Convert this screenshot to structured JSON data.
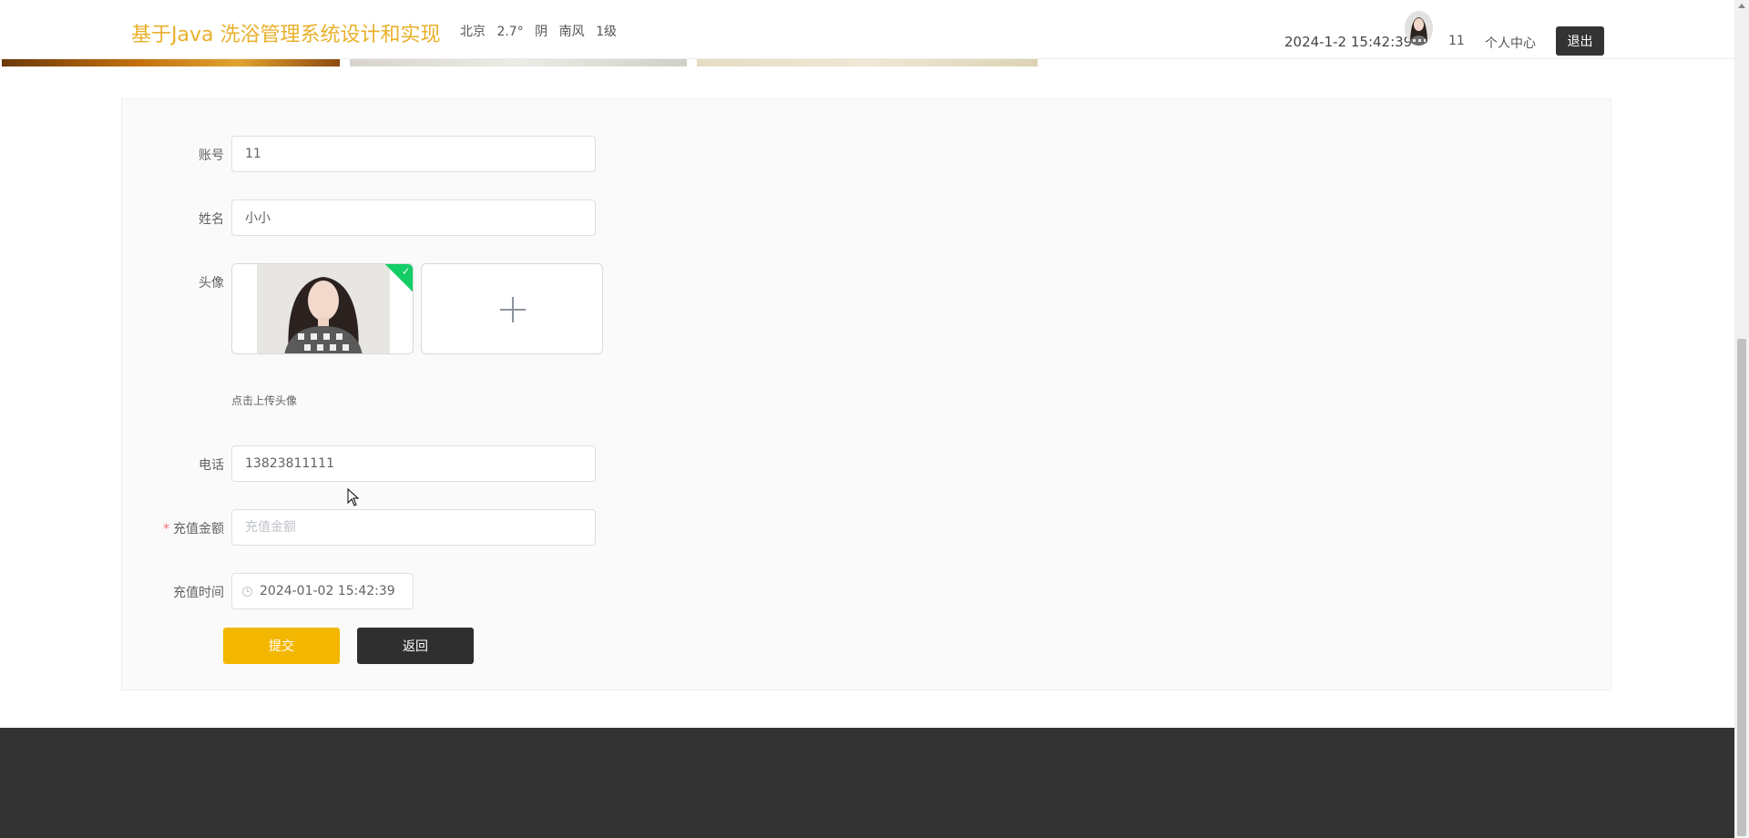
{
  "header": {
    "title": "基于Java 洗浴管理系统设计和实现",
    "weather": {
      "city": "北京",
      "temperature": "2.7°",
      "condition": "阴",
      "wind_direction": "南风",
      "wind_level": "1级"
    },
    "datetime": "2024-1-2 15:42:39",
    "username": "11",
    "profile_link": "个人中心",
    "logout_label": "退出"
  },
  "form": {
    "account": {
      "label": "账号",
      "value": "11"
    },
    "name": {
      "label": "姓名",
      "value": "小小"
    },
    "avatar": {
      "label": "头像",
      "tip": "点击上传头像"
    },
    "phone": {
      "label": "电话",
      "value": "13823811111"
    },
    "recharge_amount": {
      "label": "充值金额",
      "required_mark": "*",
      "placeholder": "充值金额",
      "value": ""
    },
    "recharge_time": {
      "label": "充值时间",
      "value": "2024-01-02 15:42:39"
    },
    "submit_label": "提交",
    "back_label": "返回"
  },
  "colors": {
    "title": "#e9b02a",
    "submit": "#f4b701",
    "back": "#2f2f2f",
    "footer": "#333333",
    "success_badge": "#13ce66"
  }
}
